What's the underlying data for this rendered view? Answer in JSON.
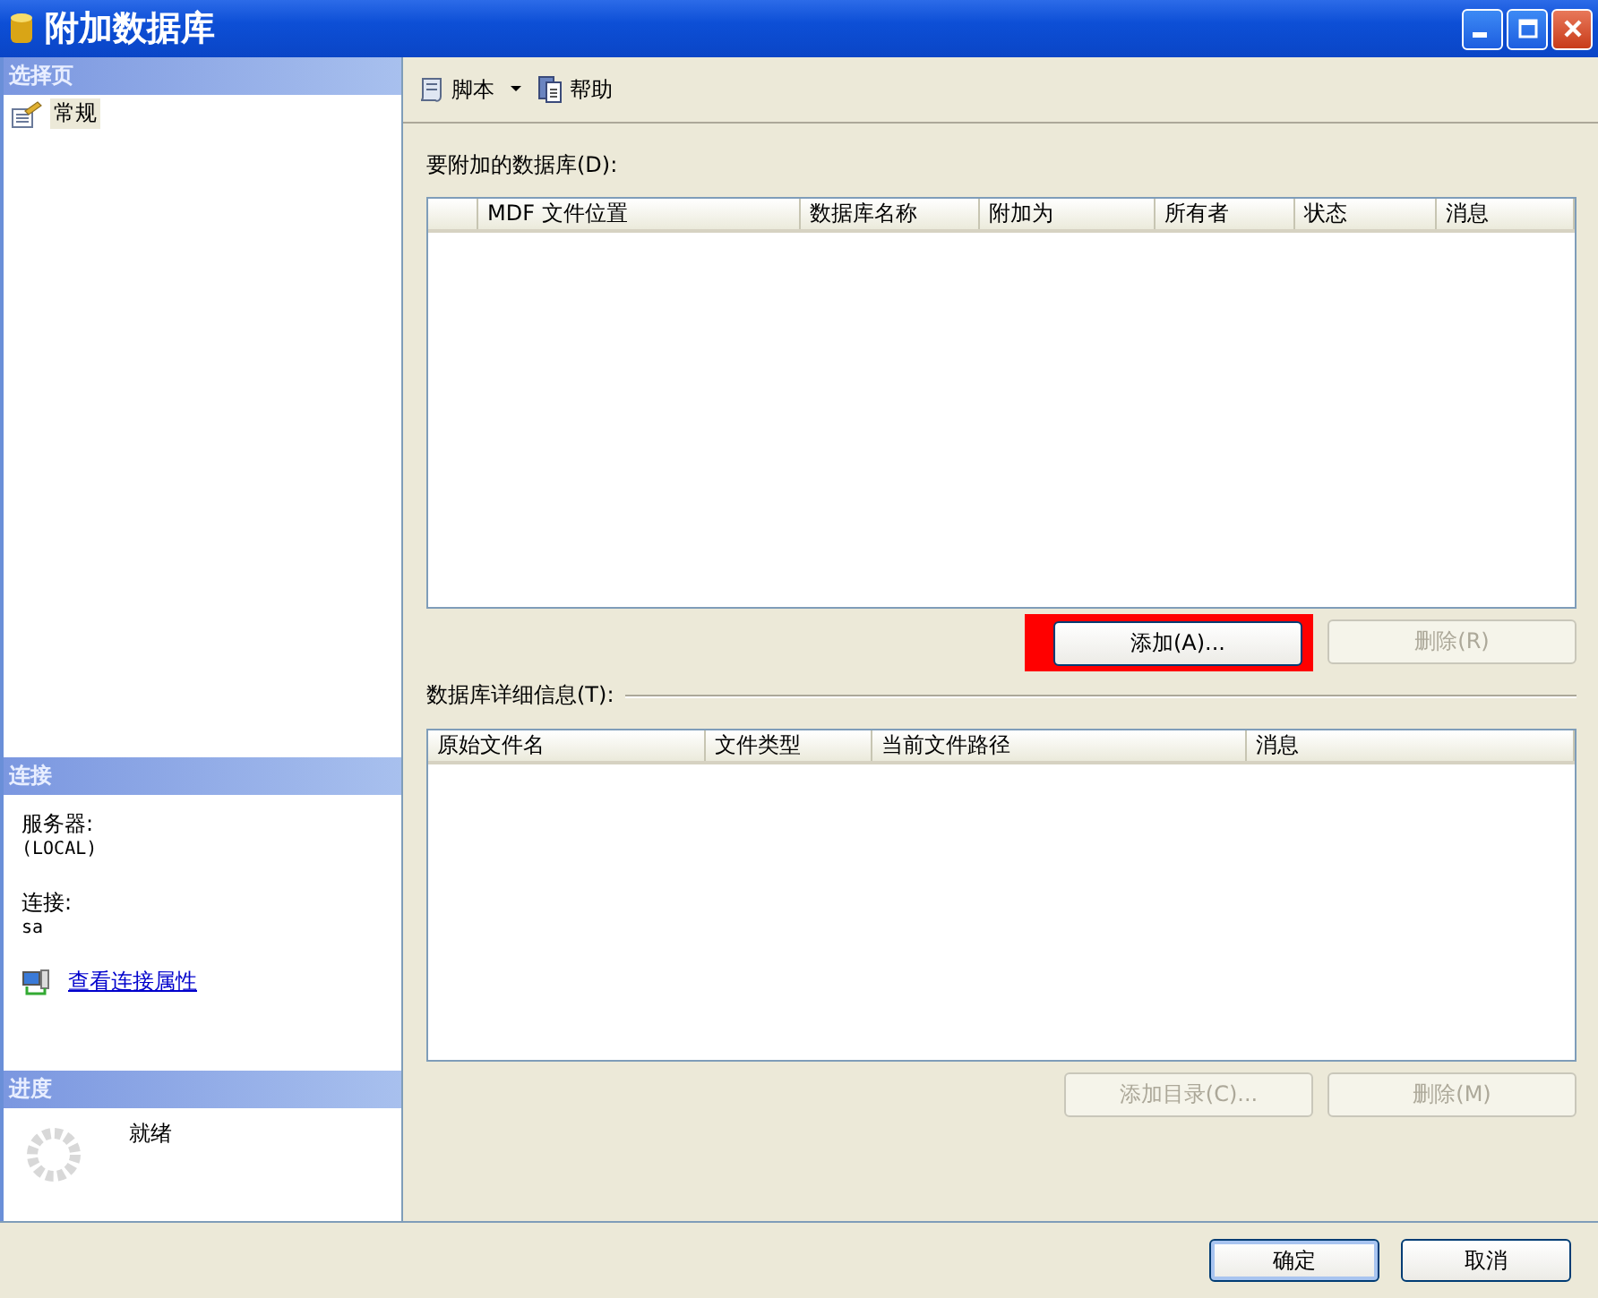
{
  "window": {
    "title": "附加数据库"
  },
  "sidebar": {
    "sections": [
      {
        "title": "选择页",
        "items": [
          {
            "label": "常规",
            "selected": true
          }
        ]
      },
      {
        "title": "连接",
        "fields": [
          {
            "label": "服务器:",
            "value": "(LOCAL)"
          },
          {
            "label": "连接:",
            "value": "sa"
          }
        ],
        "link": "查看连接属性"
      },
      {
        "title": "进度",
        "status": "就绪"
      }
    ]
  },
  "toolbar": [
    {
      "label": "脚本",
      "kind": "script"
    },
    {
      "label": "帮助",
      "kind": "help"
    }
  ],
  "attach_grid": {
    "label": "要附加的数据库(D):",
    "columns": [
      "MDF 文件位置",
      "数据库名称",
      "附加为",
      "所有者",
      "状态",
      "消息"
    ]
  },
  "attach_buttons": [
    {
      "label": "添加(A)...",
      "disabled": false,
      "highlighted": true
    },
    {
      "label": "删除(R)",
      "disabled": true,
      "highlighted": false
    }
  ],
  "details_grid": {
    "label": "数据库详细信息(T):",
    "columns": [
      "原始文件名",
      "文件类型",
      "当前文件路径",
      "消息"
    ]
  },
  "details_buttons": [
    {
      "label": "添加目录(C)...",
      "disabled": true,
      "highlighted": false
    },
    {
      "label": "删除(M)",
      "disabled": true,
      "highlighted": false
    }
  ],
  "footer_buttons": [
    {
      "label": "确定",
      "default": true
    },
    {
      "label": "取消",
      "default": false
    }
  ]
}
